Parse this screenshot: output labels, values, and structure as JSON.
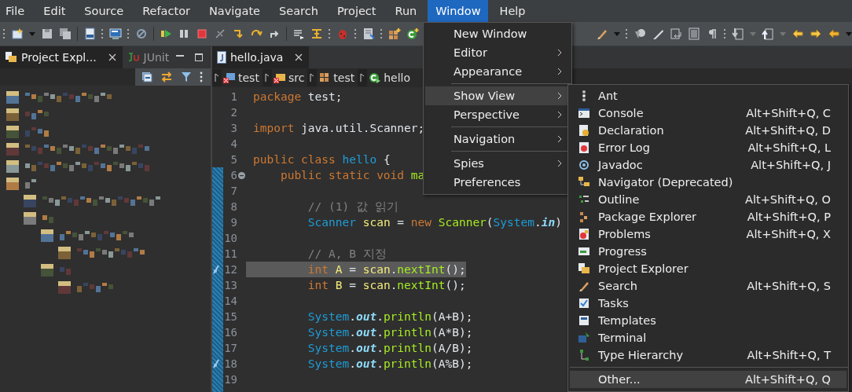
{
  "menu_bar": [
    {
      "label": "File",
      "selected": false
    },
    {
      "label": "Edit",
      "selected": false
    },
    {
      "label": "Source",
      "selected": false
    },
    {
      "label": "Refactor",
      "selected": false
    },
    {
      "label": "Navigate",
      "selected": false
    },
    {
      "label": "Search",
      "selected": false
    },
    {
      "label": "Project",
      "selected": false
    },
    {
      "label": "Run",
      "selected": false
    },
    {
      "label": "Window",
      "selected": true
    },
    {
      "label": "Help",
      "selected": false
    }
  ],
  "left_panel": {
    "tabs": [
      {
        "label": "Project Expl...",
        "selected": true,
        "closable": true
      },
      {
        "label": "JUnit",
        "selected": false,
        "closable": false
      }
    ]
  },
  "editor": {
    "tabs": [
      {
        "label": "hello.java",
        "selected": true
      }
    ],
    "breadcrumb": [
      {
        "label": "test",
        "kind": "project"
      },
      {
        "label": "src",
        "kind": "folder"
      },
      {
        "label": "test",
        "kind": "package"
      },
      {
        "label": "hello",
        "kind": "class"
      }
    ],
    "lines": [
      {
        "number": "1",
        "tokens": [
          {
            "kind": "keyword",
            "text": "package"
          },
          {
            "kind": "plain",
            "text": " test;"
          }
        ]
      },
      {
        "number": "2"
      },
      {
        "number": "3",
        "tokens": [
          {
            "kind": "keyword",
            "text": "import"
          },
          {
            "kind": "plain",
            "text": " java.util.Scanner;"
          }
        ]
      },
      {
        "number": "4"
      },
      {
        "number": "5",
        "tokens": [
          {
            "kind": "keyword",
            "text": "public class "
          },
          {
            "kind": "type",
            "text": "hello"
          },
          {
            "kind": "plain",
            "text": " {"
          }
        ]
      },
      {
        "number": "6",
        "fold": true,
        "tokens": [
          {
            "kind": "keyword",
            "text": "    public static void "
          },
          {
            "kind": "method",
            "text": "ma"
          }
        ]
      },
      {
        "number": "7"
      },
      {
        "number": "8",
        "tokens": [
          {
            "kind": "comment",
            "text": "        // (1) 값 읽기"
          }
        ]
      },
      {
        "number": "9",
        "tokens": [
          {
            "kind": "type",
            "text": "        Scanner "
          },
          {
            "kind": "var",
            "text": "scan"
          },
          {
            "kind": "plain",
            "text": " = "
          },
          {
            "kind": "keyword",
            "text": "new "
          },
          {
            "kind": "method",
            "text": "Scanner"
          },
          {
            "kind": "plain",
            "text": "("
          },
          {
            "kind": "type",
            "text": "System"
          },
          {
            "kind": "plain",
            "text": "."
          },
          {
            "kind": "field",
            "text": "in"
          },
          {
            "kind": "plain",
            "text": ")"
          }
        ]
      },
      {
        "number": "10"
      },
      {
        "number": "11",
        "tokens": [
          {
            "kind": "comment",
            "text": "        // A, B 지정"
          }
        ]
      },
      {
        "number": "12",
        "selected": true,
        "marker": true,
        "tokens": [
          {
            "kind": "keyword",
            "text": "        int "
          },
          {
            "kind": "var",
            "text": "A"
          },
          {
            "kind": "plain",
            "text": " = "
          },
          {
            "kind": "var",
            "text": "scan"
          },
          {
            "kind": "plain",
            "text": "."
          },
          {
            "kind": "method",
            "text": "nextInt"
          },
          {
            "kind": "plain",
            "text": "();"
          }
        ]
      },
      {
        "number": "13",
        "tokens": [
          {
            "kind": "keyword",
            "text": "        int "
          },
          {
            "kind": "var",
            "text": "B"
          },
          {
            "kind": "plain",
            "text": " = "
          },
          {
            "kind": "var",
            "text": "scan"
          },
          {
            "kind": "plain",
            "text": "."
          },
          {
            "kind": "method",
            "text": "nextInt"
          },
          {
            "kind": "plain",
            "text": "();"
          }
        ]
      },
      {
        "number": "14"
      },
      {
        "number": "15",
        "tokens": [
          {
            "kind": "type",
            "text": "        System"
          },
          {
            "kind": "plain",
            "text": "."
          },
          {
            "kind": "field",
            "text": "out"
          },
          {
            "kind": "plain",
            "text": "."
          },
          {
            "kind": "method",
            "text": "println"
          },
          {
            "kind": "plain",
            "text": "(A+B);"
          }
        ]
      },
      {
        "number": "16",
        "tokens": [
          {
            "kind": "type",
            "text": "        System"
          },
          {
            "kind": "plain",
            "text": "."
          },
          {
            "kind": "field",
            "text": "out"
          },
          {
            "kind": "plain",
            "text": "."
          },
          {
            "kind": "method",
            "text": "println"
          },
          {
            "kind": "plain",
            "text": "(A*B);"
          }
        ]
      },
      {
        "number": "17",
        "tokens": [
          {
            "kind": "type",
            "text": "        System"
          },
          {
            "kind": "plain",
            "text": "."
          },
          {
            "kind": "field",
            "text": "out"
          },
          {
            "kind": "plain",
            "text": "."
          },
          {
            "kind": "method",
            "text": "println"
          },
          {
            "kind": "plain",
            "text": "(A/B);"
          }
        ]
      },
      {
        "number": "18",
        "marker": true,
        "tokens": [
          {
            "kind": "type",
            "text": "        System"
          },
          {
            "kind": "plain",
            "text": "."
          },
          {
            "kind": "field",
            "text": "out"
          },
          {
            "kind": "plain",
            "text": "."
          },
          {
            "kind": "method",
            "text": "println"
          },
          {
            "kind": "plain",
            "text": "(A%B);"
          }
        ]
      },
      {
        "number": "19"
      }
    ]
  },
  "window_menu": {
    "items": [
      {
        "label": "New Window",
        "submenu": false,
        "selected": false
      },
      {
        "label": "Editor",
        "submenu": true,
        "selected": false
      },
      {
        "label": "Appearance",
        "submenu": true,
        "selected": false,
        "separator_after": true
      },
      {
        "label": "Show View",
        "submenu": true,
        "selected": true
      },
      {
        "label": "Perspective",
        "submenu": true,
        "selected": false,
        "separator_after": true
      },
      {
        "label": "Navigation",
        "submenu": true,
        "selected": false,
        "separator_after": true
      },
      {
        "label": "Spies",
        "submenu": true,
        "selected": false
      },
      {
        "label": "Preferences",
        "submenu": false,
        "selected": false
      }
    ]
  },
  "show_view_menu": {
    "items": [
      {
        "label": "Ant",
        "selected": false
      },
      {
        "label": "Console",
        "shortcut": "Alt+Shift+Q, C",
        "selected": false
      },
      {
        "label": "Declaration",
        "shortcut": "Alt+Shift+Q, D",
        "selected": false
      },
      {
        "label": "Error Log",
        "shortcut": "Alt+Shift+Q, L",
        "selected": false
      },
      {
        "label": "Javadoc",
        "shortcut": "Alt+Shift+Q, J",
        "selected": false
      },
      {
        "label": "Navigator (Deprecated)",
        "selected": false
      },
      {
        "label": "Outline",
        "shortcut": "Alt+Shift+Q, O",
        "selected": false
      },
      {
        "label": "Package Explorer",
        "shortcut": "Alt+Shift+Q, P",
        "selected": false
      },
      {
        "label": "Problems",
        "shortcut": "Alt+Shift+Q, X",
        "selected": false
      },
      {
        "label": "Progress",
        "selected": false
      },
      {
        "label": "Project Explorer",
        "selected": false
      },
      {
        "label": "Search",
        "shortcut": "Alt+Shift+Q, S",
        "selected": false
      },
      {
        "label": "Tasks",
        "selected": false
      },
      {
        "label": "Templates",
        "selected": false
      },
      {
        "label": "Terminal",
        "selected": false
      },
      {
        "label": "Type Hierarchy",
        "shortcut": "Alt+Shift+Q, T",
        "selected": false,
        "separator_after": true
      },
      {
        "label": "Other...",
        "shortcut": "Alt+Shift+Q, Q",
        "selected": true
      }
    ]
  }
}
